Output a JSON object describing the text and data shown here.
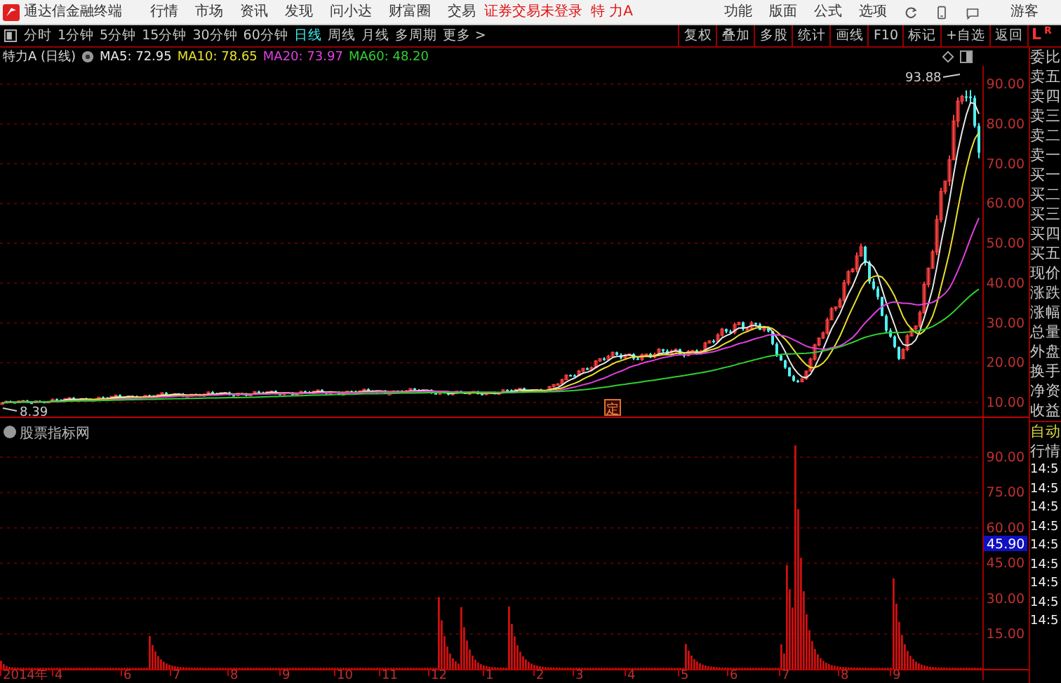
{
  "app": {
    "title": "通达信金融终端",
    "menus": [
      "行情",
      "市场",
      "资讯",
      "发现",
      "问小达",
      "财富圈",
      "交易"
    ],
    "notice": "证券交易未登录",
    "stock": "特 力A",
    "right_menus": [
      "功能",
      "版面",
      "公式",
      "选项"
    ],
    "user": "游客"
  },
  "periods": [
    {
      "label": "分时",
      "selected": false
    },
    {
      "label": "1分钟",
      "selected": false
    },
    {
      "label": "5分钟",
      "selected": false
    },
    {
      "label": "15分钟",
      "selected": false
    },
    {
      "label": "30分钟",
      "selected": false
    },
    {
      "label": "60分钟",
      "selected": false
    },
    {
      "label": "日线",
      "selected": true
    },
    {
      "label": "周线",
      "selected": false
    },
    {
      "label": "月线",
      "selected": false
    },
    {
      "label": "多周期",
      "selected": false
    },
    {
      "label": "更多 >",
      "selected": false
    }
  ],
  "tools": [
    "复权",
    "叠加",
    "多股",
    "统计",
    "画线",
    "F10",
    "标记",
    "+自选",
    "返回"
  ],
  "quote_header": [
    "L",
    "R"
  ],
  "chart": {
    "title": "特力A (日线)",
    "indicators": [
      {
        "label": "MA5: 72.95",
        "color": "#e8e8e8"
      },
      {
        "label": "MA10: 78.65",
        "color": "#e8e030"
      },
      {
        "label": "MA20: 73.97",
        "color": "#e040e0"
      },
      {
        "label": "MA60: 48.20",
        "color": "#30d030"
      }
    ],
    "high_label": "93.88",
    "low_label": "8.39",
    "marker": "定",
    "yticks": [
      "90.00",
      "80.00",
      "70.00",
      "60.00",
      "50.00",
      "40.00",
      "30.00",
      "20.00",
      "10.00"
    ]
  },
  "indicator": {
    "title": "股票指标网",
    "yticks": [
      "90.00",
      "75.00",
      "60.00",
      "45.00",
      "30.00",
      "15.00"
    ],
    "current": "45.90"
  },
  "dates": [
    "2014年",
    "4",
    "6",
    "7",
    "8",
    "9",
    "10",
    "11",
    "12",
    "1",
    "2",
    "3",
    "4",
    "5",
    "6",
    "7",
    "8",
    "9"
  ],
  "quote_fields": [
    "委比",
    "卖五",
    "卖四",
    "卖三",
    "卖二",
    "卖一",
    "买一",
    "买二",
    "买三",
    "买四",
    "买五",
    "现价",
    "涨跌",
    "涨幅",
    "总量",
    "外盘",
    "换手",
    "净资",
    "收益"
  ],
  "ticks": {
    "mode": "自动",
    "title": "行情",
    "times": [
      "14:5",
      "14:5",
      "14:5",
      "14:5",
      "14:5",
      "14:5",
      "14:5",
      "14:5",
      "14:5"
    ]
  }
}
